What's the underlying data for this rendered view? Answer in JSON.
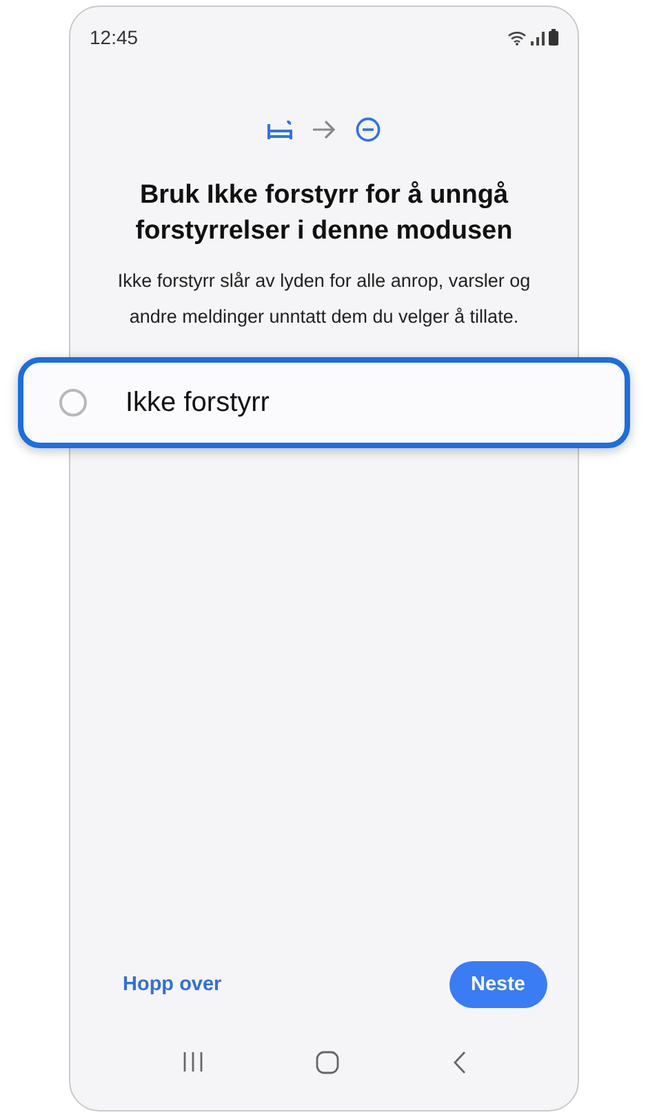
{
  "status_bar": {
    "time": "12:45"
  },
  "title": "Bruk Ikke forstyrr for å unngå forstyrrelser i denne modusen",
  "description": "Ikke forstyrr slår av lyden for alle anrop, varsler og andre meldinger unntatt dem du velger å tillate.",
  "option": {
    "label": "Ikke forstyrr",
    "selected": false
  },
  "buttons": [
    {
      "kind": "text",
      "label": "Hopp over"
    },
    {
      "kind": "filled",
      "label": "Neste"
    }
  ]
}
